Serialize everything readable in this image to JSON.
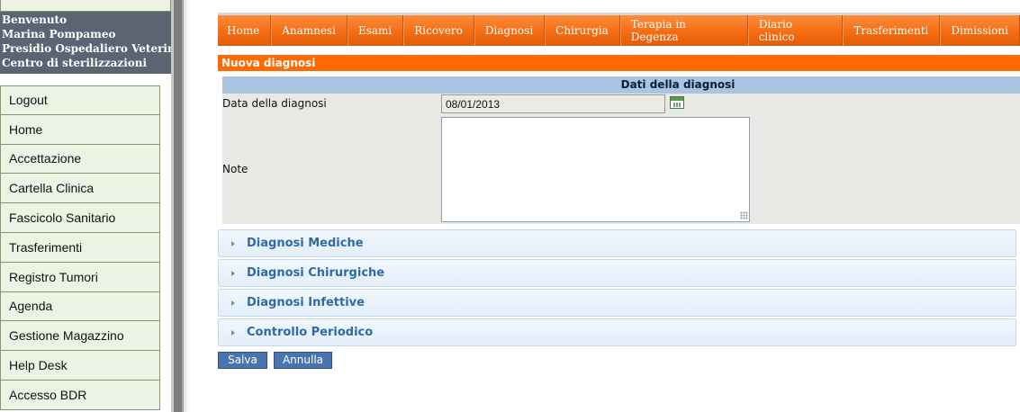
{
  "sidebar": {
    "welcome": {
      "greeting": "Benvenuto",
      "user": "Marina Pompameo",
      "facility": "Presidio Ospedaliero Veterinario",
      "unit": "Centro di sterilizzazioni"
    },
    "menu": [
      {
        "label": "Logout"
      },
      {
        "label": "Home"
      },
      {
        "label": "Accettazione"
      },
      {
        "label": "Cartella Clinica"
      },
      {
        "label": "Fascicolo Sanitario"
      },
      {
        "label": "Trasferimenti"
      },
      {
        "label": "Registro Tumori"
      },
      {
        "label": "Agenda"
      },
      {
        "label": "Gestione Magazzino"
      },
      {
        "label": "Help Desk"
      },
      {
        "label": "Accesso BDR"
      }
    ]
  },
  "nav": {
    "tabs": [
      {
        "label": "Home"
      },
      {
        "label": "Anamnesi"
      },
      {
        "label": "Esami"
      },
      {
        "label": "Ricovero"
      },
      {
        "label": "Diagnosi"
      },
      {
        "label": "Chirurgia"
      },
      {
        "label": "Terapia in Degenza"
      },
      {
        "label": "Diario clinico"
      },
      {
        "label": "Trasferimenti"
      },
      {
        "label": "Dimissioni"
      }
    ]
  },
  "section": {
    "title": "Nuova diagnosi"
  },
  "form": {
    "header": "Dati della diagnosi",
    "date_label": "Data della diagnosi",
    "date_value": "08/01/2013",
    "note_label": "Note",
    "note_value": ""
  },
  "accordion": [
    {
      "label": "Diagnosi Mediche"
    },
    {
      "label": "Diagnosi Chirurgiche"
    },
    {
      "label": "Diagnosi Infettive"
    },
    {
      "label": "Controllo Periodico"
    }
  ],
  "buttons": {
    "save": "Salva",
    "cancel": "Annulla"
  },
  "colors": {
    "nav_orange": "#f36a10",
    "section_orange": "#ff6a00",
    "form_header_blue": "#a8c4e0",
    "button_blue": "#4a74ad"
  },
  "icons": {
    "calendar": "calendar-icon",
    "accordion_arrow": "chevron-right-icon"
  }
}
